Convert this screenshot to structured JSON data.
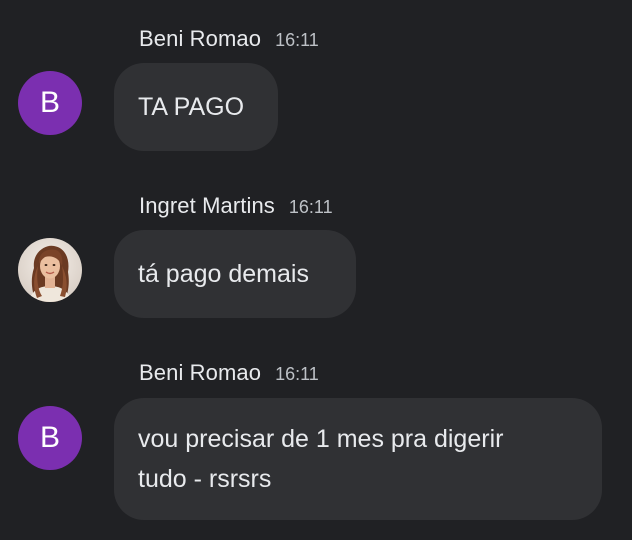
{
  "messages": [
    {
      "sender": "Beni Romao",
      "time": "16:11",
      "avatar_letter": "B",
      "text_lines": [
        "TA PAGO"
      ]
    },
    {
      "sender": "Ingret Martins",
      "time": "16:11",
      "avatar_type": "photo",
      "text_lines": [
        "tá pago demais"
      ]
    },
    {
      "sender": "Beni Romao",
      "time": "16:11",
      "avatar_letter": "B",
      "text_lines": [
        "vou precisar de 1 mes pra digerir",
        "tudo - rsrsrs"
      ]
    }
  ],
  "colors": {
    "background": "#202124",
    "bubble": "#303134",
    "avatar_b": "#7b2fb0",
    "text_primary": "#e8eaed",
    "text_secondary": "#bdc1c6"
  }
}
